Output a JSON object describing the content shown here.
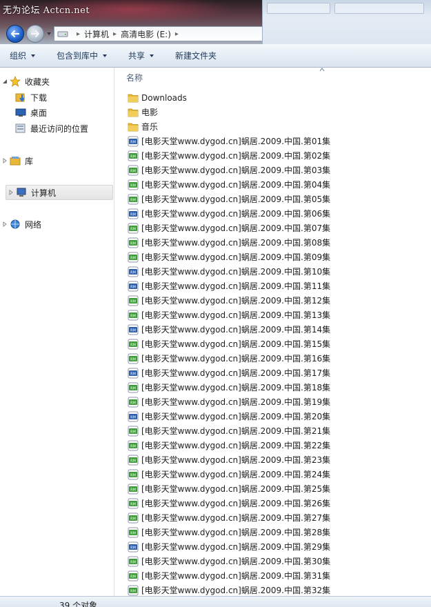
{
  "watermark": "无为论坛 Actcn.net",
  "address": {
    "crumbs": [
      "计算机",
      "高清电影 (E:)"
    ]
  },
  "toolbar": {
    "organize": "组织",
    "include_in_library": "包含到库中",
    "share": "共享",
    "new_folder": "新建文件夹"
  },
  "sidebar": {
    "favorites": "收藏夹",
    "downloads": "下载",
    "desktop": "桌面",
    "recent_places": "最近访问的位置",
    "libraries": "库",
    "computer": "计算机",
    "network": "网络"
  },
  "content": {
    "column_name": "名称",
    "folders": [
      "Downloads",
      "电影",
      "音乐"
    ],
    "files": [
      {
        "name": "[电影天堂www.dygod.cn]蜗居.2009.中国.第01集",
        "type": "rm"
      },
      {
        "name": "[电影天堂www.dygod.cn]蜗居.2009.中国.第02集",
        "type": "rmvb"
      },
      {
        "name": "[电影天堂www.dygod.cn]蜗居.2009.中国.第03集",
        "type": "rmvb"
      },
      {
        "name": "[电影天堂www.dygod.cn]蜗居.2009.中国.第04集",
        "type": "rmvb"
      },
      {
        "name": "[电影天堂www.dygod.cn]蜗居.2009.中国.第05集",
        "type": "rmvb"
      },
      {
        "name": "[电影天堂www.dygod.cn]蜗居.2009.中国.第06集",
        "type": "rm"
      },
      {
        "name": "[电影天堂www.dygod.cn]蜗居.2009.中国.第07集",
        "type": "rmvb"
      },
      {
        "name": "[电影天堂www.dygod.cn]蜗居.2009.中国.第08集",
        "type": "rmvb"
      },
      {
        "name": "[电影天堂www.dygod.cn]蜗居.2009.中国.第09集",
        "type": "rmvb"
      },
      {
        "name": "[电影天堂www.dygod.cn]蜗居.2009.中国.第10集",
        "type": "rm"
      },
      {
        "name": "[电影天堂www.dygod.cn]蜗居.2009.中国.第11集",
        "type": "rm"
      },
      {
        "name": "[电影天堂www.dygod.cn]蜗居.2009.中国.第12集",
        "type": "rmvb"
      },
      {
        "name": "[电影天堂www.dygod.cn]蜗居.2009.中国.第13集",
        "type": "rmvb"
      },
      {
        "name": "[电影天堂www.dygod.cn]蜗居.2009.中国.第14集",
        "type": "rm"
      },
      {
        "name": "[电影天堂www.dygod.cn]蜗居.2009.中国.第15集",
        "type": "rmvb"
      },
      {
        "name": "[电影天堂www.dygod.cn]蜗居.2009.中国.第16集",
        "type": "rmvb"
      },
      {
        "name": "[电影天堂www.dygod.cn]蜗居.2009.中国.第17集",
        "type": "rm"
      },
      {
        "name": "[电影天堂www.dygod.cn]蜗居.2009.中国.第18集",
        "type": "rmvb"
      },
      {
        "name": "[电影天堂www.dygod.cn]蜗居.2009.中国.第19集",
        "type": "rmvb"
      },
      {
        "name": "[电影天堂www.dygod.cn]蜗居.2009.中国.第20集",
        "type": "rm"
      },
      {
        "name": "[电影天堂www.dygod.cn]蜗居.2009.中国.第21集",
        "type": "rmvb"
      },
      {
        "name": "[电影天堂www.dygod.cn]蜗居.2009.中国.第22集",
        "type": "rmvb"
      },
      {
        "name": "[电影天堂www.dygod.cn]蜗居.2009.中国.第23集",
        "type": "rmvb"
      },
      {
        "name": "[电影天堂www.dygod.cn]蜗居.2009.中国.第24集",
        "type": "rmvb"
      },
      {
        "name": "[电影天堂www.dygod.cn]蜗居.2009.中国.第25集",
        "type": "rmvb"
      },
      {
        "name": "[电影天堂www.dygod.cn]蜗居.2009.中国.第26集",
        "type": "rmvb"
      },
      {
        "name": "[电影天堂www.dygod.cn]蜗居.2009.中国.第27集",
        "type": "rmvb"
      },
      {
        "name": "[电影天堂www.dygod.cn]蜗居.2009.中国.第28集",
        "type": "rmvb"
      },
      {
        "name": "[电影天堂www.dygod.cn]蜗居.2009.中国.第29集",
        "type": "rm"
      },
      {
        "name": "[电影天堂www.dygod.cn]蜗居.2009.中国.第30集",
        "type": "rmvb"
      },
      {
        "name": "[电影天堂www.dygod.cn]蜗居.2009.中国.第31集",
        "type": "rmvb"
      },
      {
        "name": "[电影天堂www.dygod.cn]蜗居.2009.中国.第32集",
        "type": "rmvb"
      }
    ]
  },
  "status": {
    "item_count": "39 个对象"
  },
  "colors": {
    "folder": "#e8b938",
    "rm_icon": "#2f5fa8",
    "rmvb_icon": "#3f9a3a",
    "toolbar_text": "#1e395b"
  },
  "icons": {
    "back": "back-arrow-icon",
    "forward": "forward-arrow-icon",
    "drive": "drive-icon",
    "star": "star-icon",
    "folder": "folder-icon",
    "rm": "rm-file-icon",
    "rmvb": "rmvb-file-icon"
  }
}
